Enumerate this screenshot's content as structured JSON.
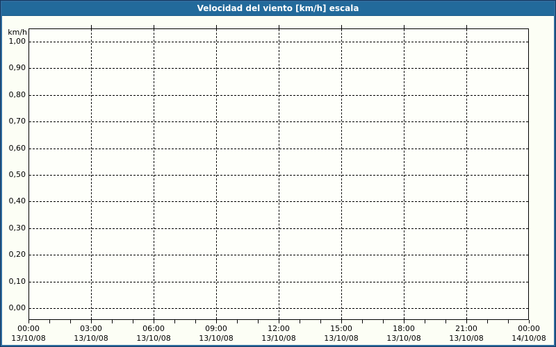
{
  "title_bar": {
    "title": "Velocidad del viento [km/h] escala",
    "bg_color": "#226A9B",
    "text_color": "#FFFFFF"
  },
  "chart_data": {
    "type": "line",
    "title": "Velocidad del viento [km/h] escala",
    "xlabel": "",
    "ylabel": "km/h",
    "ylim": [
      0.0,
      1.0
    ],
    "y_ticks": [
      {
        "label": "1,00",
        "value": 1.0
      },
      {
        "label": "0,90",
        "value": 0.9
      },
      {
        "label": "0,80",
        "value": 0.8
      },
      {
        "label": "0,70",
        "value": 0.7
      },
      {
        "label": "0,60",
        "value": 0.6
      },
      {
        "label": "0,50",
        "value": 0.5
      },
      {
        "label": "0,40",
        "value": 0.4
      },
      {
        "label": "0,30",
        "value": 0.3
      },
      {
        "label": "0,20",
        "value": 0.2
      },
      {
        "label": "0,10",
        "value": 0.1
      },
      {
        "label": "0,00",
        "value": 0.0
      }
    ],
    "x_ticks": [
      {
        "time": "00:00",
        "date": "13/10/08"
      },
      {
        "time": "03:00",
        "date": "13/10/08"
      },
      {
        "time": "06:00",
        "date": "13/10/08"
      },
      {
        "time": "09:00",
        "date": "13/10/08"
      },
      {
        "time": "12:00",
        "date": "13/10/08"
      },
      {
        "time": "15:00",
        "date": "13/10/08"
      },
      {
        "time": "18:00",
        "date": "13/10/08"
      },
      {
        "time": "21:00",
        "date": "13/10/08"
      },
      {
        "time": "00:00",
        "date": "14/10/08"
      }
    ],
    "x_major_step_hours": 3,
    "x_minor_step_hours": 1,
    "grid": {
      "style": "dashed",
      "color": "#000000",
      "horizontal": true,
      "vertical": true
    },
    "legend": {
      "visible": false
    },
    "series": []
  },
  "colors": {
    "frame_outer": "#17375E",
    "frame_inner": "#2E6C9E",
    "background": "#FCFEF5",
    "plot_background": "#FEFFFA",
    "plot_border": "#000000",
    "grid_line": "#000000",
    "tick_label": "#000000"
  }
}
